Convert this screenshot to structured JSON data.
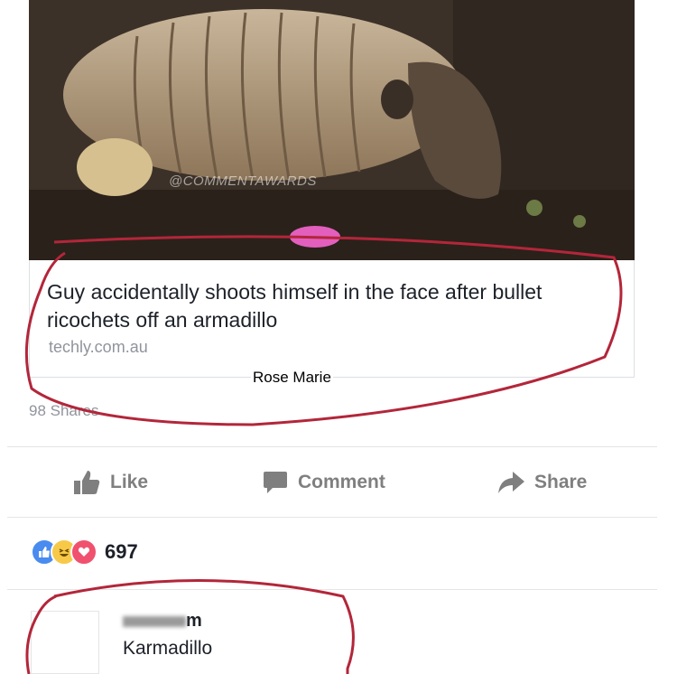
{
  "post": {
    "watermark": "@COMMENTAWARDS",
    "headline": "Guy accidentally shoots himself in the face after bullet ricochets off an armadillo",
    "domain": "techly.com.au",
    "caption": "Rose Marie",
    "shares": "98 Shares"
  },
  "actions": {
    "like_label": "Like",
    "comment_label": "Comment",
    "share_label": "Share"
  },
  "reactions": {
    "icons": [
      "like-reaction-icon",
      "haha-reaction-icon",
      "love-reaction-icon"
    ],
    "count": "697"
  },
  "comment": {
    "author_visible": "m",
    "text": "Karmadillo"
  },
  "colors": {
    "like_blue": "#4a8bf0",
    "haha_yellow": "#f7c948",
    "love_red": "#f0516e",
    "annotation_red": "#b3263a",
    "muted_text": "#90949c"
  }
}
